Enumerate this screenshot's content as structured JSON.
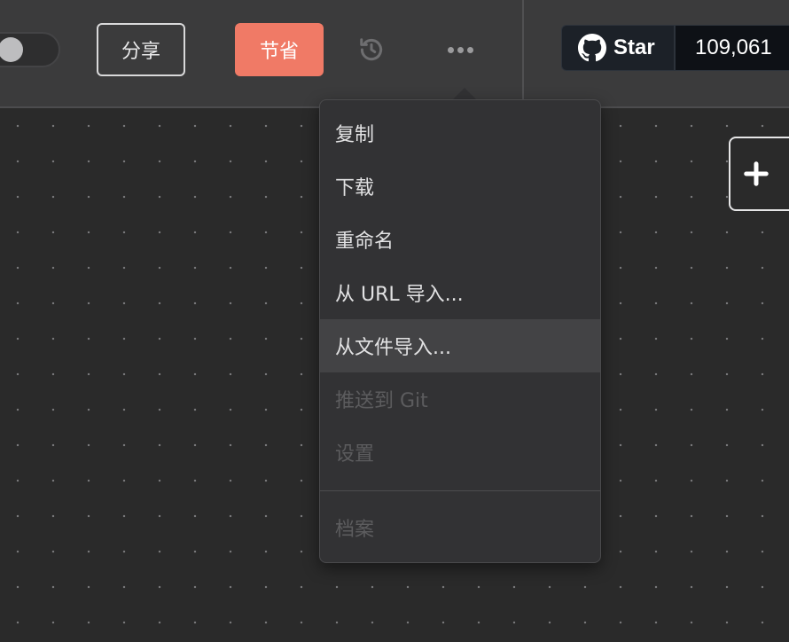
{
  "header": {
    "share_label": "分享",
    "save_label": "节省",
    "github": {
      "star_label": "Star",
      "star_count": "109,061"
    }
  },
  "menu": {
    "items": [
      {
        "label": "复制",
        "enabled": true
      },
      {
        "label": "下载",
        "enabled": true
      },
      {
        "label": "重命名",
        "enabled": true
      },
      {
        "label": "从 URL 导入...",
        "enabled": true
      },
      {
        "label": "从文件导入...",
        "enabled": true,
        "highlighted": true
      },
      {
        "label": "推送到 Git",
        "enabled": false
      },
      {
        "label": "设置",
        "enabled": false
      },
      {
        "label": "档案",
        "enabled": false
      }
    ]
  },
  "icons": {
    "toggle": "theme-toggle",
    "history": "history-icon",
    "more": "more-horizontal-icon",
    "github": "github-icon",
    "add": "plus-icon"
  },
  "colors": {
    "accent": "#f07a66",
    "background": "#2a2a2a",
    "topbar": "#3b3b3c",
    "menu": "#323234",
    "menu_hover": "#434345"
  }
}
